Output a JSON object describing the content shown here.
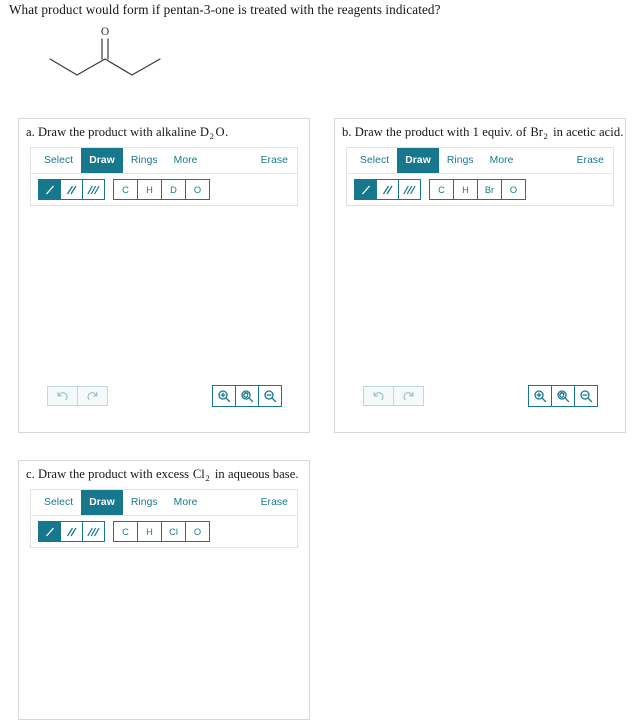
{
  "prompt": "What product would form if pentan-3-one is treated with the reagents indicated?",
  "structure": {
    "name": "pentan-3-one",
    "oxygen_label": "O"
  },
  "toolbar": {
    "tabs": [
      {
        "label": "Select",
        "active": false
      },
      {
        "label": "Draw",
        "active": true
      },
      {
        "label": "Rings",
        "active": false
      },
      {
        "label": "More",
        "active": false
      }
    ],
    "erase_label": "Erase",
    "bond_tools": [
      {
        "name": "single-bond-tool",
        "selected": true
      },
      {
        "name": "double-bond-tool",
        "selected": false
      },
      {
        "name": "triple-bond-tool",
        "selected": false
      }
    ],
    "history": [
      {
        "name": "undo-button",
        "icon": "undo-icon"
      },
      {
        "name": "redo-button",
        "icon": "redo-icon"
      }
    ],
    "zoom_controls": [
      {
        "name": "zoom-in-button",
        "icon": "magnifier-plus-icon"
      },
      {
        "name": "zoom-reset-button",
        "icon": "magnifier-reset-icon"
      },
      {
        "name": "zoom-out-button",
        "icon": "magnifier-minus-icon"
      }
    ]
  },
  "panels": [
    {
      "id": "a",
      "title_pre": "a. Draw the product with alkaline ",
      "formula": "D",
      "subscript": "2",
      "formula_post": "O",
      "title_post": ".",
      "elements": [
        "C",
        "H",
        "D",
        "O"
      ]
    },
    {
      "id": "b",
      "title_pre": "b. Draw the product with 1 equiv. of ",
      "formula": "Br",
      "subscript": "2",
      "formula_post": "",
      "title_post": " in acetic acid.",
      "elements": [
        "C",
        "H",
        "Br",
        "O"
      ]
    },
    {
      "id": "c",
      "title_pre": "c. Draw the product with excess ",
      "formula": "Cl",
      "subscript": "2",
      "formula_post": "",
      "title_post": " in aqueous base.",
      "elements": [
        "C",
        "H",
        "Cl",
        "O"
      ]
    }
  ],
  "colors": {
    "accent": "#17788d",
    "panel_border": "#d7d7d7",
    "box_border": "#e2e2e2",
    "disabled": "#8fc0cc",
    "text": "#161616"
  }
}
